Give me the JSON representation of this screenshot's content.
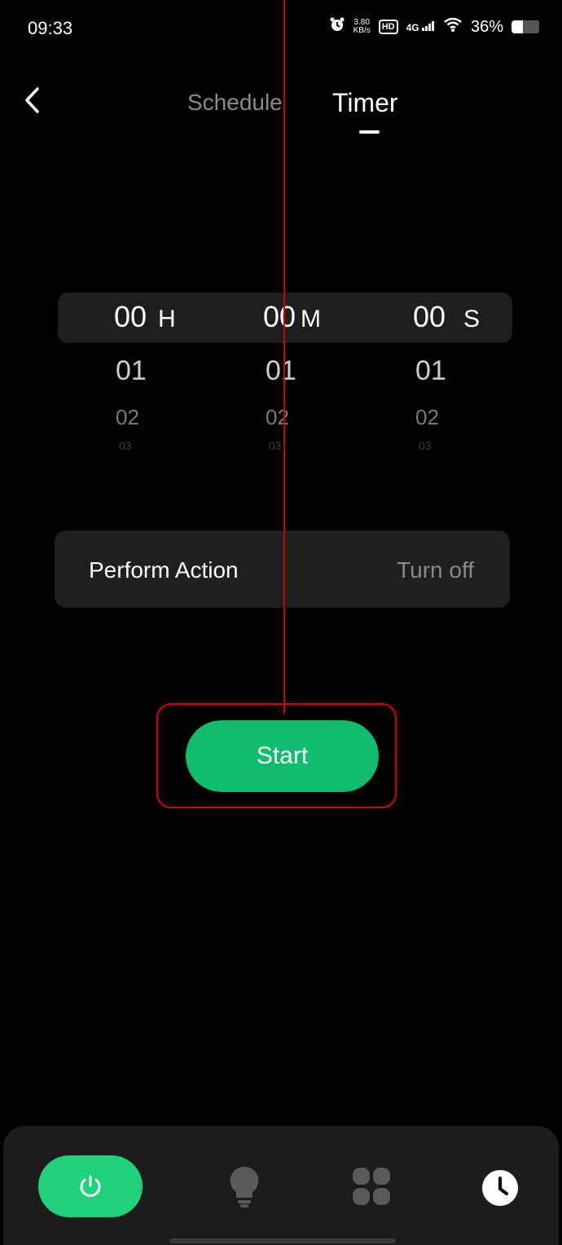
{
  "status_bar": {
    "time": "09:33",
    "net_speed_value": "3.80",
    "net_speed_unit": "KB/s",
    "hd_label": "HD",
    "network": "4G",
    "battery": "36%"
  },
  "header": {
    "tab_schedule": "Schedule",
    "tab_timer": "Timer",
    "active_tab": "Timer"
  },
  "picker": {
    "hours": {
      "selected": "00",
      "unit": "H",
      "next": [
        "01",
        "02",
        "03"
      ]
    },
    "minutes": {
      "selected": "00",
      "unit": "M",
      "next": [
        "01",
        "02",
        "03"
      ]
    },
    "seconds": {
      "selected": "00",
      "unit": "S",
      "next": [
        "01",
        "02",
        "03"
      ]
    }
  },
  "action": {
    "label": "Perform Action",
    "value": "Turn off"
  },
  "start_button": {
    "label": "Start"
  },
  "colors": {
    "accent": "#10bd6e",
    "nav_active": "#1fd17a",
    "annotation": "#d40000"
  },
  "bottom_nav": {
    "items": [
      {
        "icon": "power-icon",
        "active": true
      },
      {
        "icon": "lightbulb-icon",
        "active": false
      },
      {
        "icon": "scenes-icon",
        "active": false
      },
      {
        "icon": "clock-icon",
        "active": false
      }
    ]
  }
}
